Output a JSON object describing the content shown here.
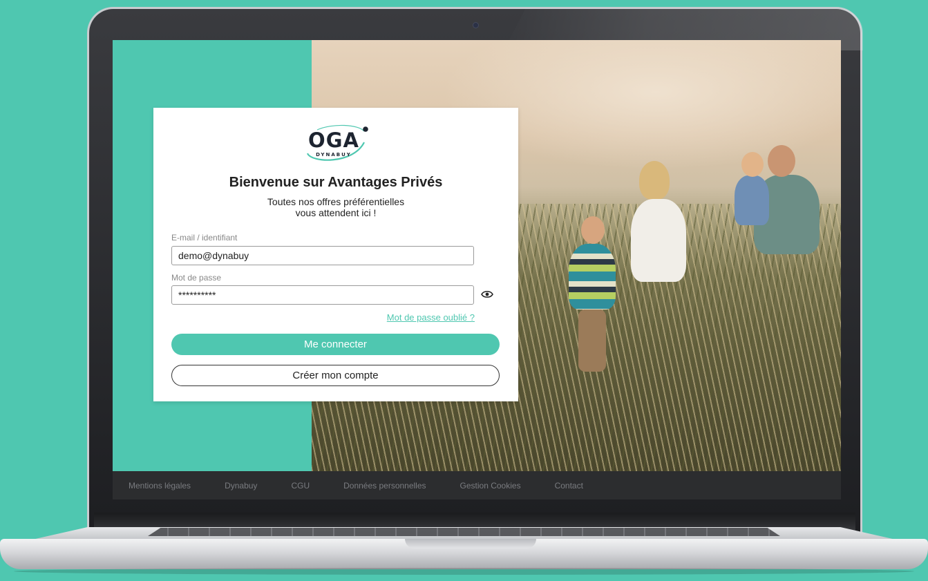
{
  "login": {
    "logo_text": "OGA",
    "logo_subtext": "DYNABUY",
    "title": "Bienvenue sur Avantages Privés",
    "subtitle_line1": "Toutes nos offres préférentielles",
    "subtitle_line2": "vous attendent ici !",
    "email_label": "E-mail / identifiant",
    "email_value": "demo@dynabuy",
    "password_label": "Mot de passe",
    "password_value": "**********",
    "forgot_link": "Mot de passe oublié ?",
    "login_button": "Me connecter",
    "create_account_button": "Créer mon compte",
    "show_password_icon": "eye-icon"
  },
  "footer": {
    "links": [
      "Mentions légales",
      "Dynabuy",
      "CGU",
      "Données personnelles",
      "Gestion Cookies",
      "Contact"
    ]
  },
  "colors": {
    "brand_teal": "#4fc7b0",
    "footer_bg": "#2c2d2f"
  }
}
